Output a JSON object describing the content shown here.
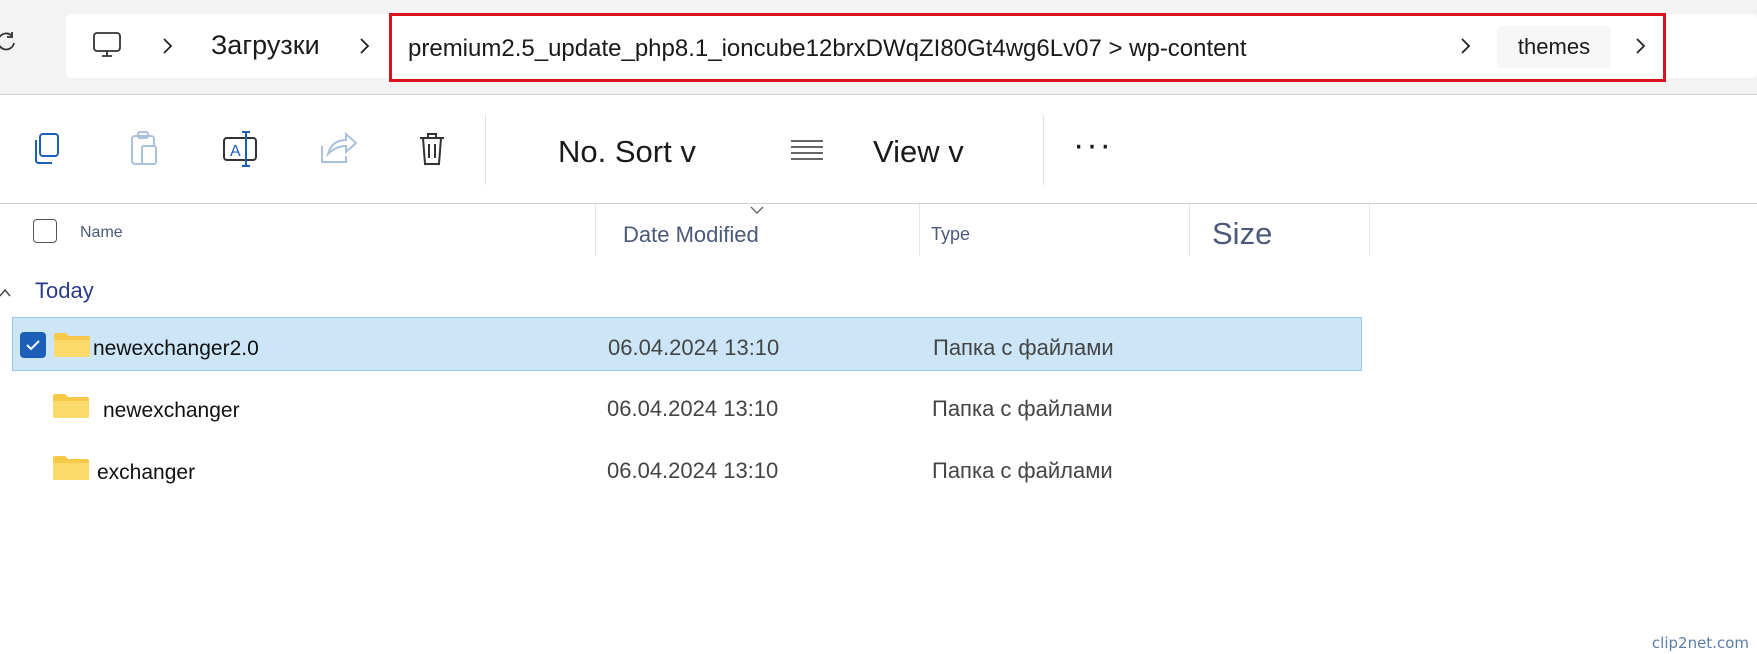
{
  "address": {
    "crumb_downloads": "Загрузки",
    "path_value": "premium2.5_update_php8.1_ioncube12brxDWqZI80Gt4wg6Lv07 > wp-content",
    "crumb_themes": "themes"
  },
  "toolbar": {
    "sort_label": "No. Sort v",
    "view_label": "View v",
    "more_label": "···"
  },
  "columns": {
    "name": "Name",
    "date": "Date Modified",
    "type": "Type",
    "size": "Size"
  },
  "group": {
    "label": "Today"
  },
  "rows": [
    {
      "name": "newexchanger2.0",
      "date": "06.04.2024 13:10",
      "type": "Папка с файлами",
      "selected": true
    },
    {
      "name": "newexchanger",
      "date": "06.04.2024 13:10",
      "type": "Папка с файлами",
      "selected": false
    },
    {
      "name": "exchanger",
      "date": "06.04.2024 13:10",
      "type": "Папка с файлами",
      "selected": false
    }
  ],
  "watermark": "clip2net.com",
  "colors": {
    "accent": "#1c5fb8",
    "selection": "#cde6f7",
    "highlight_box": "#d9131e",
    "folder": "#f7c948"
  }
}
